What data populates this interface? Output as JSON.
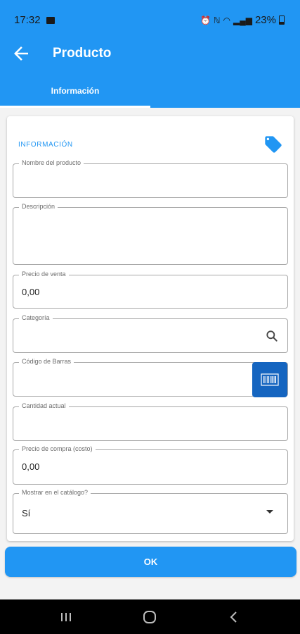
{
  "status_bar": {
    "time": "17:32",
    "battery": "23%"
  },
  "app_bar": {
    "title": "Producto",
    "tab_label": "Información"
  },
  "card": {
    "title": "INFORMACIÓN"
  },
  "fields": {
    "nombre": {
      "label": "Nombre del producto",
      "value": ""
    },
    "descripcion": {
      "label": "Descripción",
      "value": ""
    },
    "precio_venta": {
      "label": "Precio de venta",
      "value": "0,00"
    },
    "categoria": {
      "label": "Categoría",
      "value": ""
    },
    "codigo_barras": {
      "label": "Código de Barras",
      "value": ""
    },
    "cantidad": {
      "label": "Cantidad actual",
      "value": ""
    },
    "precio_compra": {
      "label": "Precio de compra (costo)",
      "value": "0,00"
    },
    "catalogo": {
      "label": "Mostrar en el catálogo?",
      "value": "Sí"
    }
  },
  "actions": {
    "ok_label": "OK"
  },
  "colors": {
    "primary": "#2196f3",
    "barcode_button": "#1565c0",
    "background": "#f3f3f3"
  },
  "icons": {
    "back": "arrow-left-icon",
    "tag": "tag-icon",
    "search": "search-icon",
    "barcode": "barcode-icon",
    "dropdown": "caret-down-icon"
  }
}
